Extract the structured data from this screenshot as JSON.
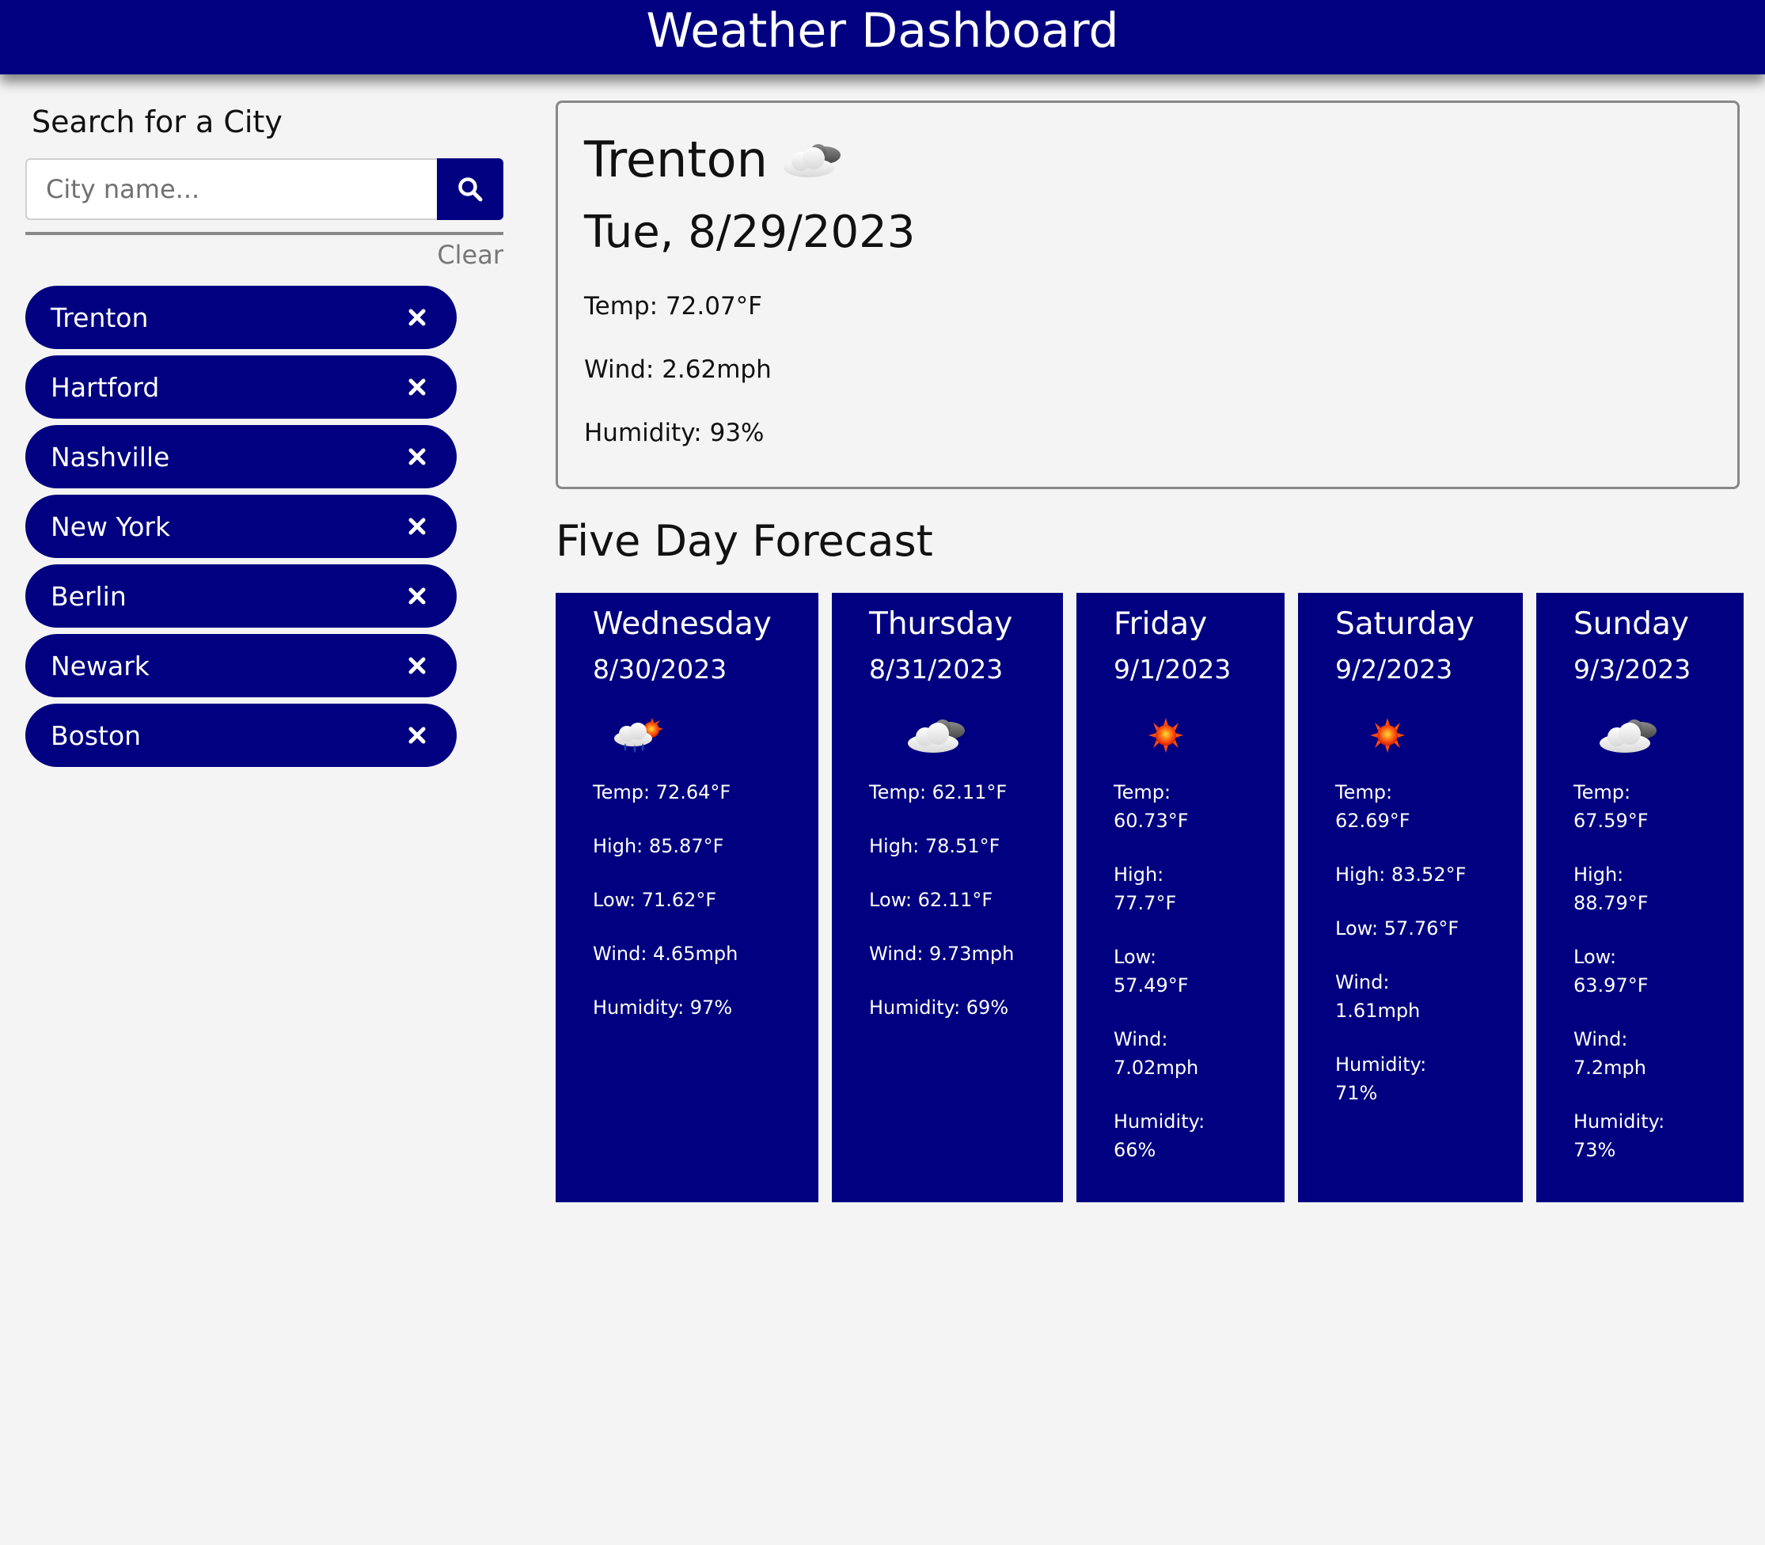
{
  "header": {
    "title": "Weather Dashboard"
  },
  "colors": {
    "primary": "#000080",
    "background": "#f4f4f4",
    "border": "#888888"
  },
  "sidebar": {
    "title": "Search for a City",
    "search_placeholder": "City name...",
    "search_icon": "search-icon",
    "clear_label": "Clear",
    "cities": [
      {
        "name": "Trenton"
      },
      {
        "name": "Hartford"
      },
      {
        "name": "Nashville"
      },
      {
        "name": "New York"
      },
      {
        "name": "Berlin"
      },
      {
        "name": "Newark"
      },
      {
        "name": "Boston"
      }
    ]
  },
  "current": {
    "city": "Trenton",
    "icon": "partly-cloudy-icon",
    "date": "Tue, 8/29/2023",
    "temp": "Temp: 72.07°F",
    "wind": "Wind: 2.62mph",
    "humidity": "Humidity: 93%"
  },
  "forecast": {
    "title": "Five Day Forecast",
    "days": [
      {
        "day": "Wednesday",
        "date": "8/30/2023",
        "icon": "sun-rain-cloud-icon",
        "temp": "Temp: 72.64°F",
        "high": "High: 85.87°F",
        "low": "Low: 71.62°F",
        "wind": "Wind: 4.65mph",
        "humidity": "Humidity: 97%"
      },
      {
        "day": "Thursday",
        "date": "8/31/2023",
        "icon": "partly-cloudy-icon",
        "temp": "Temp: 62.11°F",
        "high": "High: 78.51°F",
        "low": "Low: 62.11°F",
        "wind": "Wind: 9.73mph",
        "humidity": "Humidity: 69%"
      },
      {
        "day": "Friday",
        "date": "9/1/2023",
        "icon": "sun-icon",
        "temp": "Temp: 60.73°F",
        "high": "High: 77.7°F",
        "low": "Low: 57.49°F",
        "wind": "Wind: 7.02mph",
        "humidity": "Humidity: 66%"
      },
      {
        "day": "Saturday",
        "date": "9/2/2023",
        "icon": "sun-icon",
        "temp": "Temp: 62.69°F",
        "high": "High: 83.52°F",
        "low": "Low: 57.76°F",
        "wind": "Wind: 1.61mph",
        "humidity": "Humidity: 71%"
      },
      {
        "day": "Sunday",
        "date": "9/3/2023",
        "icon": "partly-cloudy-icon",
        "temp": "Temp: 67.59°F",
        "high": "High: 88.79°F",
        "low": "Low: 63.97°F",
        "wind": "Wind: 7.2mph",
        "humidity": "Humidity: 73%"
      }
    ]
  }
}
